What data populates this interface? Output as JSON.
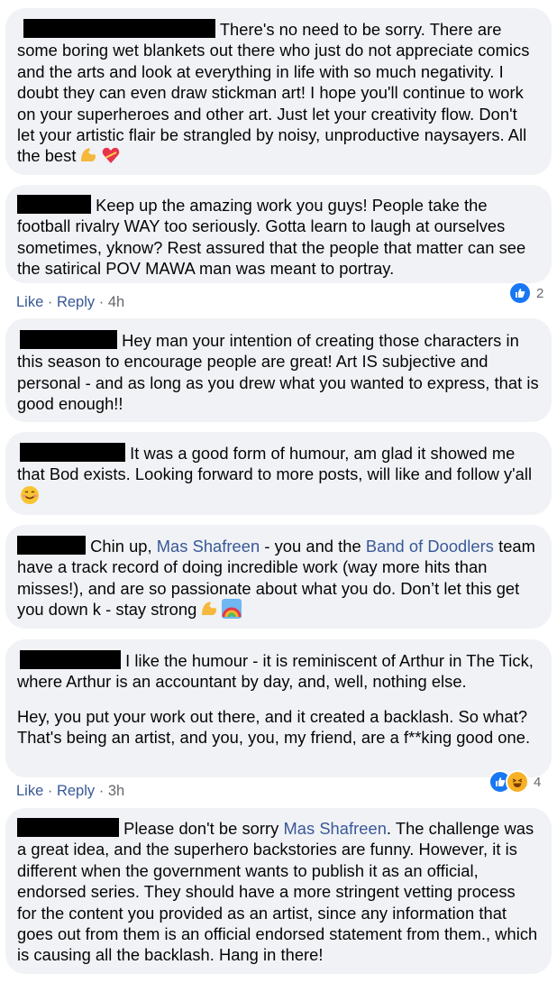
{
  "comments": [
    {
      "text": "There's no need to be sorry. There are some boring wet blankets out there who just do not appreciate comics and the arts and look at everything in life with so much negativity. I doubt they can even draw stickman art! I hope you'll continue to work on your superheroes and other art. Just let your creativity flow. Don't let your artistic flair be strangled by noisy, unproductive naysayers. All the best",
      "emojis": [
        "flexed-biceps",
        "heart-with-ribbon"
      ]
    },
    {
      "text": "Keep up the amazing work you guys! People take the football rivalry WAY too seriously. Gotta learn to laugh at ourselves sometimes, yknow? Rest assured that the people that matter can see the satirical POV MAWA man was meant to portray.",
      "actions": {
        "like": "Like",
        "reply": "Reply",
        "time": "4h"
      },
      "reactions": {
        "count": "2",
        "icons": [
          "like-icon"
        ]
      }
    },
    {
      "text": "Hey man your intention of creating those characters in this season to encourage people are great! Art IS subjective and personal - and as long as you drew what you wanted to express, that is good enough!!"
    },
    {
      "text": "It was a good form of humour, am glad it showed me that Bod exists. Looking forward to more posts, will like and follow y'all",
      "emojis": [
        "smiling-face"
      ]
    },
    {
      "text_1": "Chin up,",
      "mention_1": "Mas Shafreen",
      "text_2": "- you and the",
      "mention_2": "Band of Doodlers",
      "text_3": "team have a track record of doing incredible work (way more hits than misses!), and are so passionate about what you do. Don’t let this get you down k - stay strong",
      "emojis": [
        "flexed-biceps",
        "rainbow"
      ]
    },
    {
      "para_1": "I like the humour - it is reminiscent of Arthur in The Tick, where Arthur is an accountant by day, and, well, nothing else.",
      "para_2": "Hey, you put your work out there, and it created a backlash. So what? That's being an artist, and you, you, my friend, are a f**king good one.",
      "actions": {
        "like": "Like",
        "reply": "Reply",
        "time": "3h"
      },
      "reactions": {
        "count": "4",
        "icons": [
          "like-icon",
          "haha-icon"
        ]
      }
    },
    {
      "text_1": "Please don't be sorry",
      "mention_1": "Mas Shafreen",
      "text_2": ". The challenge was a great idea, and the superhero backstories are funny. However, it is different when the government wants to publish it as an official, endorsed series. They should have a more stringent vetting process for the content you provided as an artist, since any information that goes out from them is an official endorsed statement from them., which is causing all the backlash. Hang in there!"
    }
  ],
  "separator": "·",
  "colors": {
    "bubble": "#f0f2f5",
    "link": "#385898",
    "meta": "#65676b",
    "like": "#1877f2"
  }
}
